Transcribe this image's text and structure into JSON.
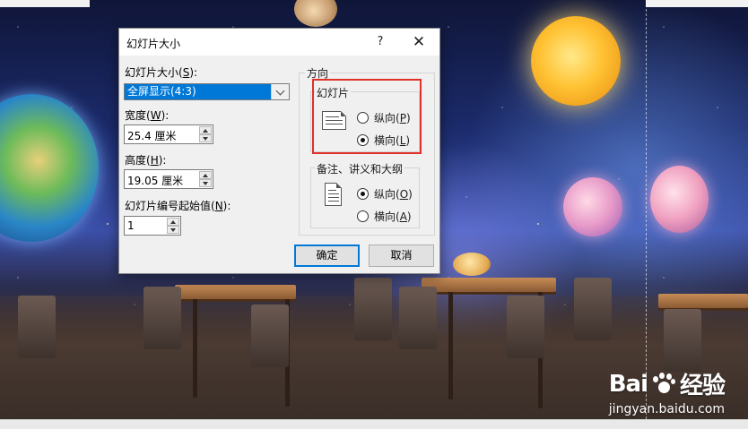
{
  "dialog": {
    "title": "幻灯片大小",
    "help_label": "?",
    "close_label": "✕",
    "slide_size": {
      "label_prefix": "幻灯片大小(",
      "label_key": "S",
      "label_suffix": "):",
      "selected_value": "全屏显示(4:3)"
    },
    "width": {
      "label_prefix": "宽度(",
      "label_key": "W",
      "label_suffix": "):",
      "value": "25.4 厘米"
    },
    "height": {
      "label_prefix": "高度(",
      "label_key": "H",
      "label_suffix": "):",
      "value": "19.05 厘米"
    },
    "numbering": {
      "label_prefix": "幻灯片编号起始值(",
      "label_key": "N",
      "label_suffix": "):",
      "value": "1"
    },
    "orientation": {
      "group_title": "方向",
      "slides": {
        "group_title": "幻灯片",
        "portrait": {
          "label_prefix": "纵向(",
          "label_key": "P",
          "label_suffix": ")",
          "checked": false
        },
        "landscape": {
          "label_prefix": "横向(",
          "label_key": "L",
          "label_suffix": ")",
          "checked": true
        }
      },
      "notes": {
        "group_title": "备注、讲义和大纲",
        "portrait": {
          "label_prefix": "纵向(",
          "label_key": "O",
          "label_suffix": ")",
          "checked": true
        },
        "landscape": {
          "label_prefix": "横向(",
          "label_key": "A",
          "label_suffix": ")",
          "checked": false
        }
      }
    },
    "ok_label": "确定",
    "cancel_label": "取消"
  },
  "watermark": {
    "logo_left": "Bai",
    "logo_right": "经验",
    "url": "jingyan.baidu.com"
  },
  "colors": {
    "selection_blue": "#0078d7",
    "highlight_red": "#e0302a",
    "dialog_bg": "#f0f0f0"
  }
}
